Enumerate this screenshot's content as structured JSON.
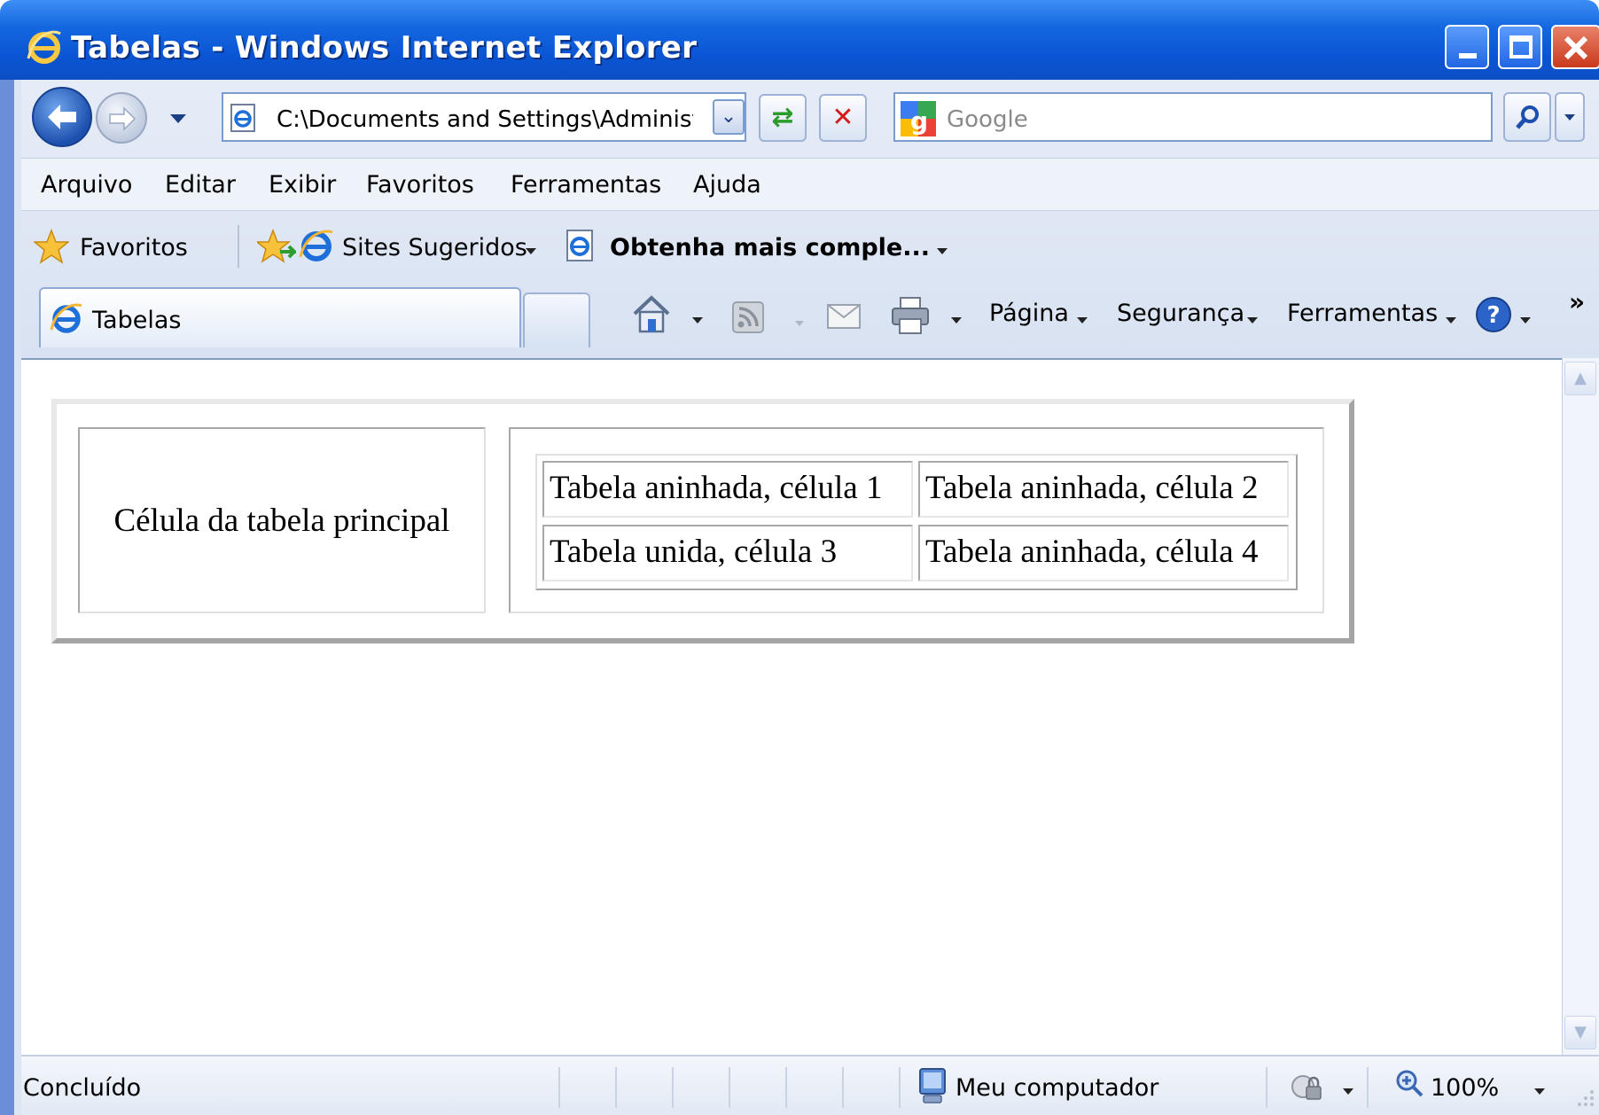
{
  "window": {
    "title": "Tabelas - Windows Internet Explorer"
  },
  "nav": {
    "address": "C:\\Documents and Settings\\Administr...",
    "search_placeholder": "Google"
  },
  "menu": [
    "Arquivo",
    "Editar",
    "Exibir",
    "Favoritos",
    "Ferramentas",
    "Ajuda"
  ],
  "favorites_bar": {
    "favorites_label": "Favoritos",
    "suggested_sites": "Sites Sugeridos",
    "get_more": "Obtenha mais comple..."
  },
  "tab": {
    "label": "Tabelas"
  },
  "command_bar": {
    "page": "Página",
    "safety": "Segurança",
    "tools": "Ferramentas",
    "more": "»"
  },
  "page": {
    "main_cell": "Célula da tabela principal",
    "nested_cells": [
      "Tabela aninhada, célula 1",
      "Tabela aninhada, célula 2",
      "Tabela unida, célula 3",
      "Tabela aninhada, célula 4"
    ]
  },
  "status": {
    "text": "Concluído",
    "zone": "Meu computador",
    "zoom": "100%"
  }
}
